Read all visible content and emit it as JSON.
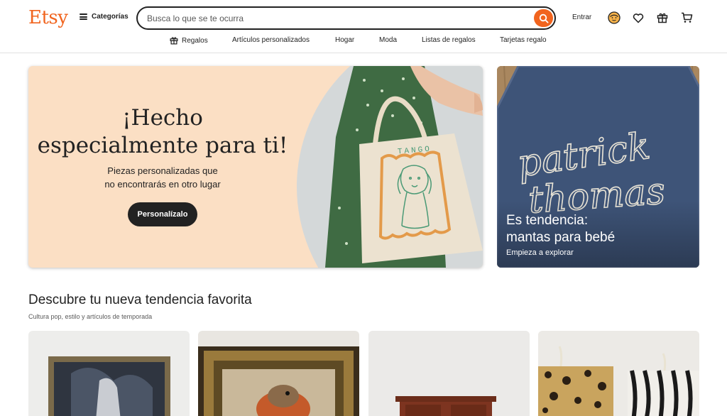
{
  "header": {
    "logo": "Etsy",
    "categories_label": "Categorías",
    "search_placeholder": "Busca lo que se te ocurra",
    "signin_label": "Entrar"
  },
  "subnav": {
    "items": [
      "Regalos",
      "Artículos personalizados",
      "Hogar",
      "Moda",
      "Listas de regalos",
      "Tarjetas regalo"
    ]
  },
  "hero": {
    "title_line1": "¡Hecho",
    "title_line2": "especialmente para ti!",
    "subtitle_line1": "Piezas personalizadas que",
    "subtitle_line2": "no encontrarás en otro lugar",
    "button_label": "Personalízalo",
    "bag_text": "TANGO"
  },
  "promo": {
    "title_line1": "Es tendencia:",
    "title_line2": "mantas para bebé",
    "subtitle": "Empieza a explorar",
    "blanket_text_line1": "patrick",
    "blanket_text_line2": "thomas"
  },
  "section": {
    "title": "Descubre tu nueva tendencia favorita",
    "subtitle": "Cultura pop, estilo y artículos de temporada"
  },
  "colors": {
    "brand": "#f1641e",
    "hero_bg": "#fbdfc4",
    "dark": "#222222"
  },
  "icons": [
    "hamburger-icon",
    "search-icon",
    "avatar-icon",
    "heart-icon",
    "gift-icon",
    "cart-icon"
  ]
}
